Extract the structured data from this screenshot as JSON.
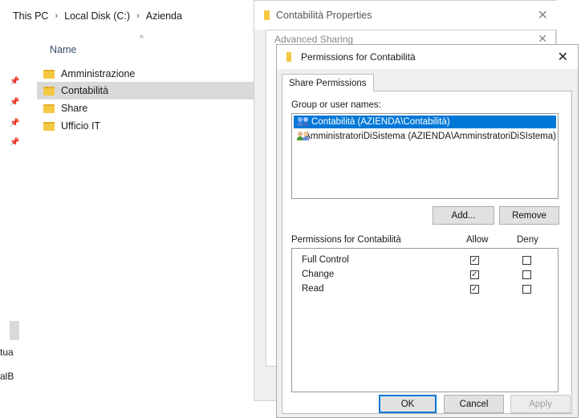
{
  "explorer": {
    "breadcrumb": [
      "This PC",
      "Local Disk (C:)",
      "Azienda"
    ],
    "breadcrumb_sep": "›",
    "column_name": "Name",
    "sort_caret": "^",
    "files": [
      {
        "name": "Amministrazione",
        "selected": false
      },
      {
        "name": "Contabilità",
        "selected": true
      },
      {
        "name": "Share",
        "selected": false
      },
      {
        "name": "Ufficio IT",
        "selected": false
      }
    ],
    "pin_icon": "pin-icon",
    "cut_text_1": "tua",
    "cut_text_2": "alB"
  },
  "properties": {
    "title": "Contabilità Properties",
    "close": "✕",
    "advanced_sharing_title": "Advanced Sharing",
    "advanced_close": "✕"
  },
  "permissions_dialog": {
    "title": "Permissions for Contabilità",
    "close": "✕",
    "tab": "Share Permissions",
    "group_label": "Group or user names:",
    "users": [
      {
        "name": "Contabilità (AZIENDA\\Contabilità)",
        "selected": true,
        "icon": "users-icon"
      },
      {
        "name": "AmministratoriDiSistema (AZIENDA\\AmminstratoriDiSIstema)",
        "selected": false,
        "icon": "users-icon"
      }
    ],
    "add_button": "Add...",
    "remove_button": "Remove",
    "perm_header": "Permissions for Contabilità",
    "allow_header": "Allow",
    "deny_header": "Deny",
    "permissions": [
      {
        "name": "Full Control",
        "allow": true,
        "deny": false
      },
      {
        "name": "Change",
        "allow": true,
        "deny": false
      },
      {
        "name": "Read",
        "allow": true,
        "deny": false
      }
    ],
    "checkmark": "✓",
    "ok_button": "OK",
    "cancel_button": "Cancel",
    "apply_button": "Apply"
  },
  "colors": {
    "selection": "#0078d7",
    "folder": "#f5c842",
    "explorer_selection": "#d9d9d9"
  }
}
